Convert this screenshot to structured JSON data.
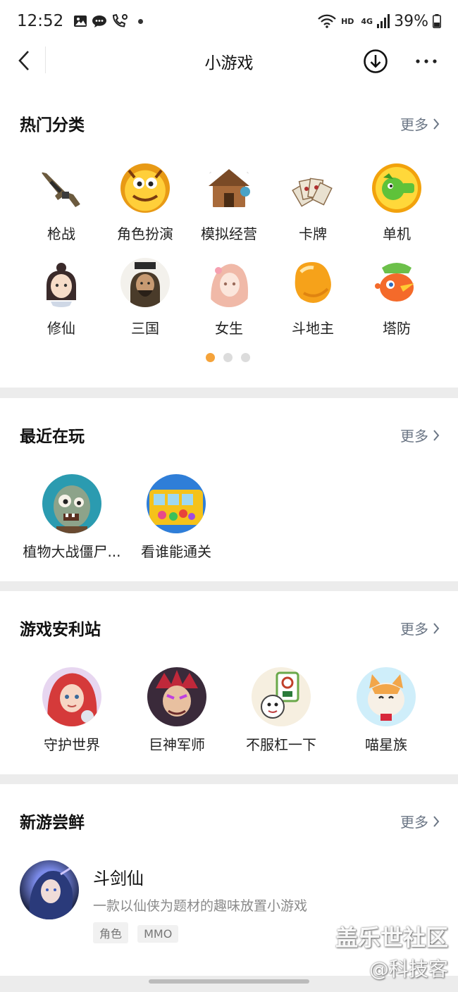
{
  "status_bar": {
    "time": "12:52",
    "network_label": "HD",
    "signal_label": "4G",
    "battery": "39%"
  },
  "nav": {
    "title": "小游戏"
  },
  "hot_categories": {
    "title": "热门分类",
    "more": "更多",
    "items": [
      {
        "label": "枪战",
        "icon": "rifle-icon"
      },
      {
        "label": "角色扮演",
        "icon": "monster-icon"
      },
      {
        "label": "模拟经营",
        "icon": "house-icon"
      },
      {
        "label": "卡牌",
        "icon": "cards-icon"
      },
      {
        "label": "单机",
        "icon": "peashooter-icon"
      },
      {
        "label": "修仙",
        "icon": "cultivator-icon"
      },
      {
        "label": "三国",
        "icon": "general-icon"
      },
      {
        "label": "女生",
        "icon": "girl-icon"
      },
      {
        "label": "斗地主",
        "icon": "jelly-icon"
      },
      {
        "label": "塔防",
        "icon": "bird-icon"
      }
    ],
    "page_count": 3,
    "active_page": 1
  },
  "recent": {
    "title": "最近在玩",
    "more": "更多",
    "items": [
      {
        "label": "植物大战僵尸...",
        "icon": "zombie-icon"
      },
      {
        "label": "看谁能通关",
        "icon": "school-bus-icon"
      }
    ]
  },
  "recommend": {
    "title": "游戏安利站",
    "more": "更多",
    "items": [
      {
        "label": "守护世界",
        "icon": "red-hair-girl-icon"
      },
      {
        "label": "巨神军师",
        "icon": "warrior-icon"
      },
      {
        "label": "不服杠一下",
        "icon": "mahjong-icon"
      },
      {
        "label": "喵星族",
        "icon": "cat-icon"
      }
    ]
  },
  "new_games": {
    "title": "新游尝鲜",
    "more": "更多",
    "game": {
      "name": "斗剑仙",
      "desc": "一款以仙侠为题材的趣味放置小游戏",
      "tags": [
        "角色",
        "MMO"
      ]
    }
  },
  "watermark": {
    "line1": "盖乐世社区",
    "line2": "@科技客"
  }
}
